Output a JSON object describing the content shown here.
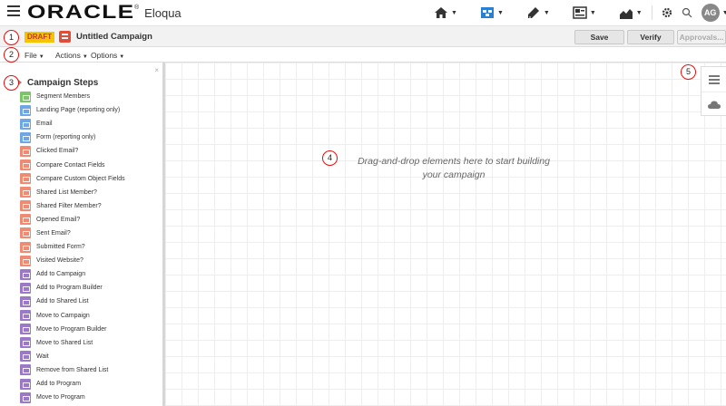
{
  "topbar": {
    "logo_text": "ORACLE",
    "logo_mark": "®",
    "product": "Eloqua",
    "icons": [
      "home-icon",
      "campaign-icon",
      "assets-icon",
      "contacts-icon",
      "analytics-icon",
      "settings-icon",
      "search-icon"
    ],
    "avatar_initials": "AG"
  },
  "titlebar": {
    "status": "DRAFT",
    "campaign_name": "Untitled Campaign",
    "buttons": {
      "save": "Save",
      "verify": "Verify",
      "approvals": "Approvals..."
    }
  },
  "menubar": {
    "items": [
      "File",
      "Actions",
      "Options"
    ]
  },
  "sidebar": {
    "close_glyph": "×",
    "title": "Campaign Steps",
    "steps": [
      {
        "label": "Segment Members",
        "color": "#7cc46a"
      },
      {
        "label": "Landing Page (reporting only)",
        "color": "#6fa7e6"
      },
      {
        "label": "Email",
        "color": "#6fa7e6"
      },
      {
        "label": "Form (reporting only)",
        "color": "#6fa7e6"
      },
      {
        "label": "Clicked Email?",
        "color": "#ef8a73"
      },
      {
        "label": "Compare Contact Fields",
        "color": "#ef8a73"
      },
      {
        "label": "Compare Custom Object Fields",
        "color": "#ef8a73"
      },
      {
        "label": "Shared List Member?",
        "color": "#ef8a73"
      },
      {
        "label": "Shared Filter Member?",
        "color": "#ef8a73"
      },
      {
        "label": "Opened Email?",
        "color": "#ef8a73"
      },
      {
        "label": "Sent Email?",
        "color": "#ef8a73"
      },
      {
        "label": "Submitted Form?",
        "color": "#ef8a73"
      },
      {
        "label": "Visited Website?",
        "color": "#ef8a73"
      },
      {
        "label": "Add to Campaign",
        "color": "#9a79c9"
      },
      {
        "label": "Add to Program Builder",
        "color": "#9a79c9"
      },
      {
        "label": "Add to Shared List",
        "color": "#9a79c9"
      },
      {
        "label": "Move to Campaign",
        "color": "#9a79c9"
      },
      {
        "label": "Move to Program Builder",
        "color": "#9a79c9"
      },
      {
        "label": "Move to Shared List",
        "color": "#9a79c9"
      },
      {
        "label": "Wait",
        "color": "#9a79c9"
      },
      {
        "label": "Remove from Shared List",
        "color": "#9a79c9"
      },
      {
        "label": "Add to Program",
        "color": "#9a79c9"
      },
      {
        "label": "Move to Program",
        "color": "#9a79c9"
      }
    ]
  },
  "canvas": {
    "hint_line1": "Drag-and-drop elements here to start building",
    "hint_line2": "your campaign"
  },
  "right_panel": {
    "icons": [
      "list-icon",
      "cloud-icon"
    ]
  },
  "callouts": [
    "1",
    "2",
    "3",
    "4",
    "5"
  ]
}
